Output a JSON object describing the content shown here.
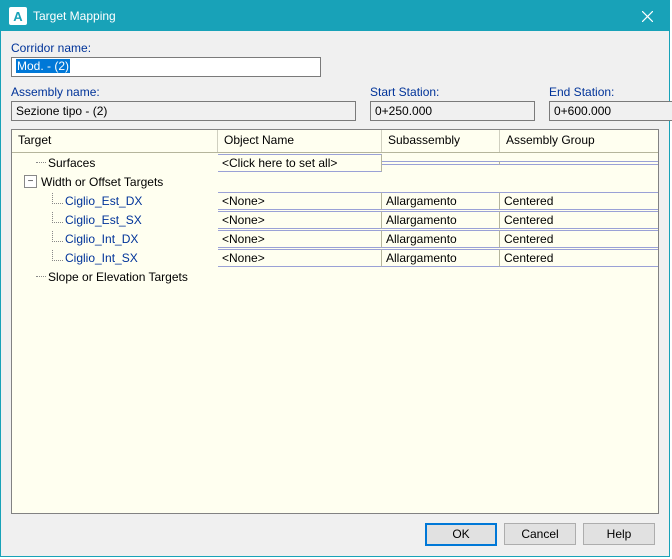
{
  "window": {
    "title": "Target Mapping",
    "app_letter": "A"
  },
  "labels": {
    "corridor": "Corridor name:",
    "assembly": "Assembly name:",
    "start": "Start Station:",
    "end": "End Station:"
  },
  "values": {
    "corridor": "Mod. - (2)",
    "assembly": "Sezione tipo - (2)",
    "start": "0+250.000",
    "end": "0+600.000"
  },
  "grid": {
    "headers": {
      "target": "Target",
      "object": "Object Name",
      "sub": "Subassembly",
      "group": "Assembly Group"
    },
    "surfaces_label": "Surfaces",
    "width_label": "Width or Offset Targets",
    "slope_label": "Slope or Elevation Targets",
    "click_all": "<Click here to set all>",
    "rows": [
      {
        "name": "Ciglio_Est_DX",
        "obj": "<None>",
        "sub": "Allargamento",
        "grp": "Centered"
      },
      {
        "name": "Ciglio_Est_SX",
        "obj": "<None>",
        "sub": "Allargamento",
        "grp": "Centered"
      },
      {
        "name": "Ciglio_Int_DX",
        "obj": "<None>",
        "sub": "Allargamento",
        "grp": "Centered"
      },
      {
        "name": "Ciglio_Int_SX",
        "obj": "<None>",
        "sub": "Allargamento",
        "grp": "Centered"
      }
    ]
  },
  "buttons": {
    "ok": "OK",
    "cancel": "Cancel",
    "help": "Help"
  }
}
